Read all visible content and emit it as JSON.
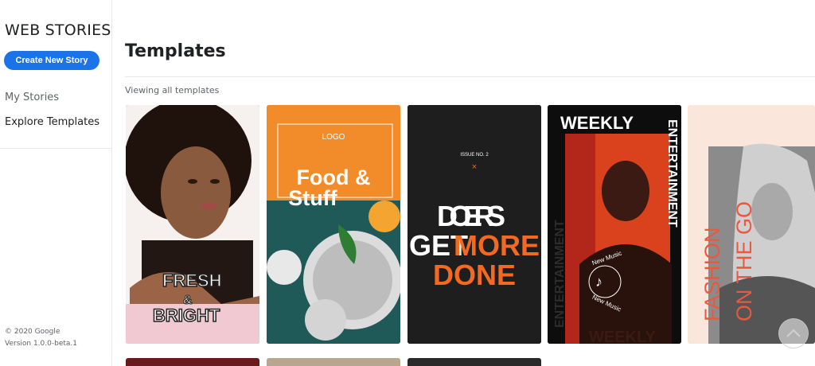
{
  "sidebar": {
    "brand": "WEB STORIES",
    "create_label": "Create New Story",
    "nav": [
      "My Stories",
      "Explore Templates"
    ],
    "footer": {
      "copyright": "© 2020 Google",
      "version": "Version 1.0.0-beta.1"
    }
  },
  "main": {
    "title": "Templates",
    "subtitle": "Viewing all templates"
  },
  "templates": [
    {
      "text_line1": "FRESH",
      "text_line2": "&",
      "text_line3": "BRIGHT"
    },
    {
      "logo": "LOGO",
      "text_line1": "Food &",
      "text_line2": "Stuff"
    },
    {
      "issue": "ISSUE NO. 2",
      "mark": "×",
      "text_line1": "DOERS",
      "text_line2a": "GET",
      "text_line2b": "MORE",
      "text_line3": "DONE"
    },
    {
      "text_top": "WEEKLY",
      "text_side": "ENTERTAINMENT",
      "text_side_left": "ENTERTAINMENT",
      "badge_line1": "New Music",
      "badge_line2": "New Music",
      "bottom_text": "WEEKLY"
    },
    {
      "text_line1": "FASHION",
      "text_line2": "ON THE GO"
    }
  ],
  "colors": {
    "accent": "#1a73e8",
    "orange": "#f28c2a",
    "doers_orange": "#f26a21",
    "fashion_red": "#e8593f"
  },
  "icons": {
    "scroll_top": "chevron-up-icon"
  }
}
